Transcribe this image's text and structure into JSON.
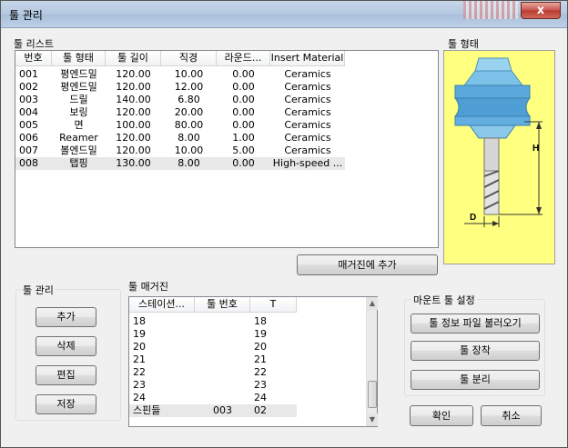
{
  "window": {
    "title": "툴 관리",
    "close_glyph": "x"
  },
  "tool_list": {
    "label": "툴 리스트",
    "columns": [
      "번호",
      "툴 형태",
      "툴 길이",
      "직경",
      "라운드...",
      "Insert Material"
    ],
    "rows": [
      [
        "001",
        "평엔드밀",
        "120.00",
        "10.00",
        "0.00",
        "Ceramics"
      ],
      [
        "002",
        "평엔드밀",
        "120.00",
        "12.00",
        "0.00",
        "Ceramics"
      ],
      [
        "003",
        "드릴",
        "140.00",
        "6.80",
        "0.00",
        "Ceramics"
      ],
      [
        "004",
        "보링",
        "120.00",
        "20.00",
        "0.00",
        "Ceramics"
      ],
      [
        "005",
        "면",
        "100.00",
        "80.00",
        "0.00",
        "Ceramics"
      ],
      [
        "006",
        "Reamer",
        "120.00",
        "8.00",
        "1.00",
        "Ceramics"
      ],
      [
        "007",
        "볼엔드밀",
        "120.00",
        "10.00",
        "5.00",
        "Ceramics"
      ],
      [
        "008",
        "탭핑",
        "130.00",
        "8.00",
        "0.00",
        "High-speed ..."
      ]
    ]
  },
  "tool_shape": {
    "label": "툴 형태",
    "dim_h": "H",
    "dim_d": "D"
  },
  "add_to_magazine": "매거진에 추가",
  "tool_manage": {
    "label": "툴 관리",
    "buttons": [
      "추가",
      "삭제",
      "편집",
      "저장"
    ]
  },
  "magazine": {
    "label": "툴 매거진",
    "columns": [
      "스테이션...",
      "툴 번호",
      "T"
    ],
    "rows": [
      [
        "18",
        "",
        "18"
      ],
      [
        "19",
        "",
        "19"
      ],
      [
        "20",
        "",
        "20"
      ],
      [
        "21",
        "",
        "21"
      ],
      [
        "22",
        "",
        "22"
      ],
      [
        "23",
        "",
        "23"
      ],
      [
        "24",
        "",
        "24"
      ],
      [
        "스핀들",
        "003",
        "02"
      ]
    ]
  },
  "mount": {
    "label": "마운트 툴 설정",
    "buttons": [
      "툴 정보 파일 불러오기",
      "툴 장착",
      "툴 분리"
    ]
  },
  "ok": "확인",
  "cancel": "취소"
}
